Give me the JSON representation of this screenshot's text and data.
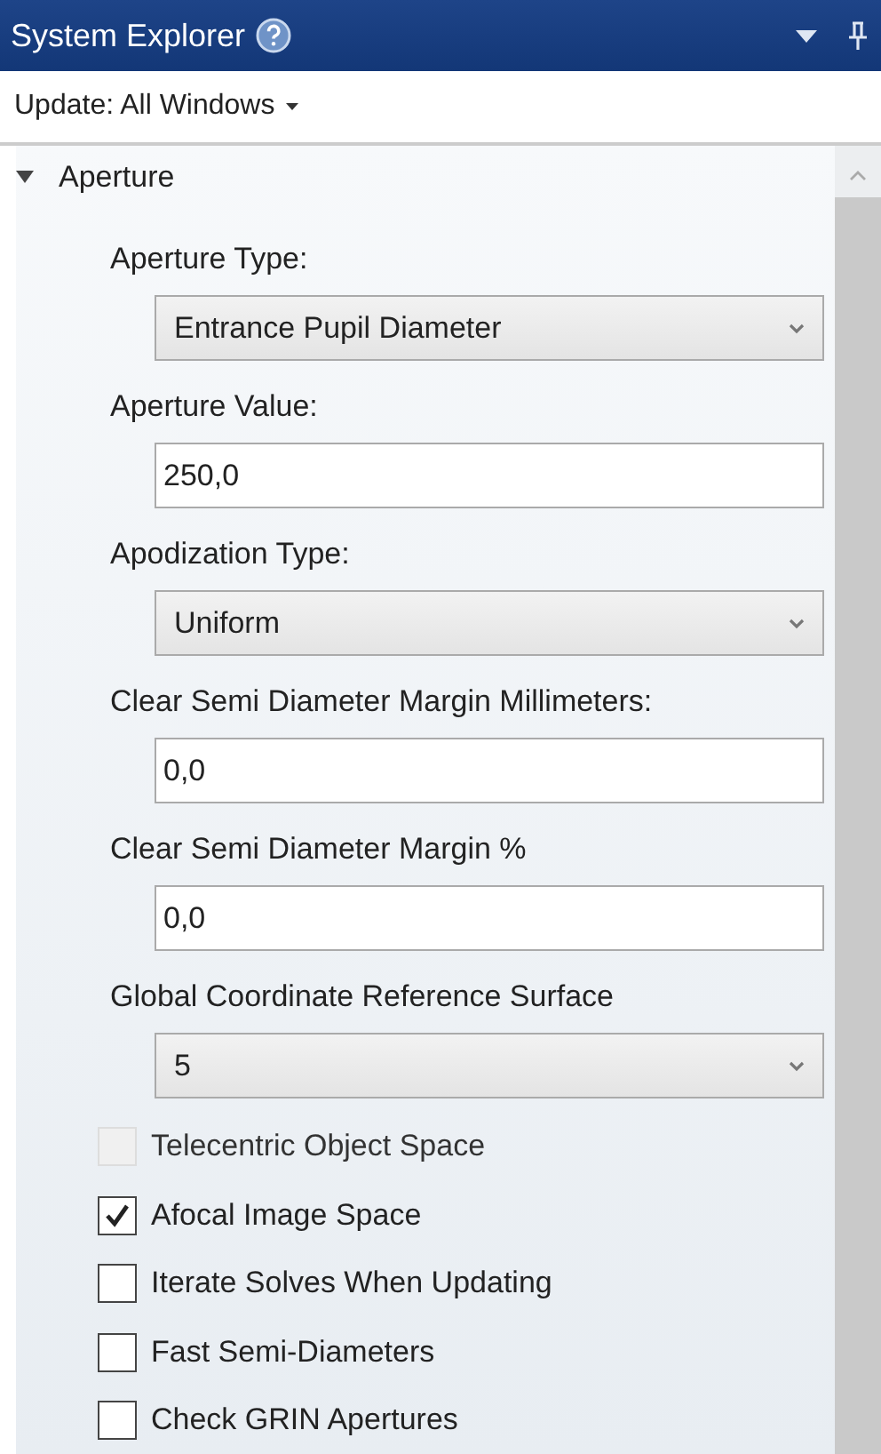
{
  "window": {
    "title": "System Explorer"
  },
  "toolbar": {
    "update_label": "Update: All Windows"
  },
  "section": {
    "title": "Aperture",
    "expanded": true,
    "fields": [
      {
        "kind": "dropdown",
        "label": "Aperture Type:",
        "value": "Entrance Pupil Diameter"
      },
      {
        "kind": "text",
        "label": "Aperture Value:",
        "value": "250,0"
      },
      {
        "kind": "dropdown",
        "label": "Apodization Type:",
        "value": "Uniform"
      },
      {
        "kind": "text",
        "label": "Clear Semi Diameter Margin Millimeters:",
        "value": "0,0"
      },
      {
        "kind": "text",
        "label": "Clear Semi Diameter Margin %",
        "value": "0,0"
      },
      {
        "kind": "dropdown",
        "label": "Global Coordinate Reference Surface",
        "value": "5"
      }
    ],
    "checkboxes": [
      {
        "label": "Telecentric Object Space",
        "checked": false,
        "disabled": true
      },
      {
        "label": "Afocal Image Space",
        "checked": true,
        "disabled": false
      },
      {
        "label": "Iterate Solves When Updating",
        "checked": false,
        "disabled": false
      },
      {
        "label": "Fast Semi-Diameters",
        "checked": false,
        "disabled": false
      },
      {
        "label": "Check GRIN Apertures",
        "checked": false,
        "disabled": false
      }
    ]
  }
}
